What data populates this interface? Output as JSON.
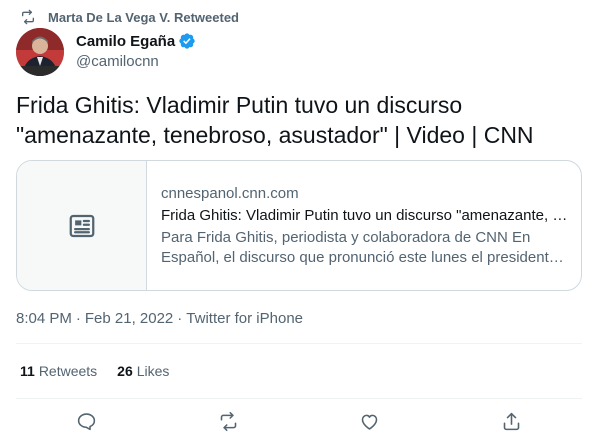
{
  "social_context": {
    "text": "Marta De La Vega V. Retweeted",
    "icon": "retweet-icon"
  },
  "author": {
    "display_name": "Camilo Egaña",
    "handle": "@camilocnn",
    "verified": true,
    "avatar_icon": "avatar-photo"
  },
  "tweet": {
    "text": "Frida Ghitis: Vladimir Putin tuvo un discurso \"amenazante, tenebroso, asustador\" | Video | CNN"
  },
  "link_card": {
    "thumb_icon": "article-icon",
    "domain": "cnnespanol.cnn.com",
    "title": "Frida Ghitis: Vladimir Putin tuvo un discurso \"amenazante, tenebroso, asustador\" | Video | CNN",
    "description": "Para Frida Ghitis, periodista y colaboradora de CNN En Español, el discurso que pronunció este lunes el presidente de Rusia, Vladimir Putin"
  },
  "meta": {
    "time": "8:04 PM",
    "separator": "·",
    "date": "Feb 21, 2022",
    "source": "Twitter for iPhone"
  },
  "stats": {
    "retweets": {
      "count": "11",
      "label": "Retweets"
    },
    "likes": {
      "count": "26",
      "label": "Likes"
    }
  },
  "actions": [
    "reply-icon",
    "retweet-icon",
    "like-icon",
    "share-icon"
  ],
  "colors": {
    "text": "#0f1419",
    "secondary": "#536471",
    "border": "#cfd9de",
    "verified": "#1d9bf0",
    "card_thumb_bg": "#f7f9f9"
  }
}
